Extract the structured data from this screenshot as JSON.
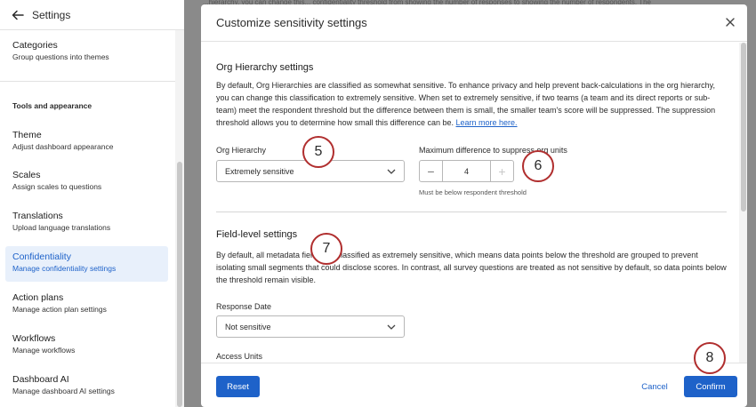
{
  "sidebar": {
    "title": "Settings",
    "back_icon": "arrow-left-icon",
    "top_item": {
      "title": "Categories",
      "subtitle": "Group questions into themes"
    },
    "section_label": "Tools and appearance",
    "items": [
      {
        "title": "Theme",
        "subtitle": "Adjust dashboard appearance"
      },
      {
        "title": "Scales",
        "subtitle": "Assign scales to questions"
      },
      {
        "title": "Translations",
        "subtitle": "Upload language translations"
      },
      {
        "title": "Confidentiality",
        "subtitle": "Manage confidentiality settings",
        "active": true
      },
      {
        "title": "Action plans",
        "subtitle": "Manage action plan settings"
      },
      {
        "title": "Workflows",
        "subtitle": "Manage workflows"
      },
      {
        "title": "Dashboard AI",
        "subtitle": "Manage dashboard AI settings"
      }
    ]
  },
  "background_text": "...hierarchy, you can change this... confidentiality threshold from showing the number of responses to showing the number of respondents. The",
  "modal": {
    "title": "Customize sensitivity settings",
    "close_icon": "close-icon",
    "org_section": {
      "heading": "Org Hierarchy settings",
      "description": "By default, Org Hierarchies are classified as somewhat sensitive. To enhance privacy and help prevent back-calculations in the org hierarchy, you can change this classification to extremely sensitive. When set to extremely sensitive, if two teams (a team and its direct reports or sub-team) meet the respondent threshold but the difference between them is small, the smaller team's score will be suppressed. The suppression threshold allows you to determine how small this difference can be.",
      "learn_more": "Learn more here.",
      "org_hierarchy_label": "Org Hierarchy",
      "org_hierarchy_value": "Extremely sensitive",
      "max_diff_label": "Maximum difference to suppress org units",
      "max_diff_value": "4",
      "minus": "−",
      "plus": "+",
      "hint": "Must be below respondent threshold"
    },
    "field_section": {
      "heading": "Field-level settings",
      "description": "By default, all metadata fields are classified as extremely sensitive, which means data points below the threshold are grouped to prevent isolating small segments that could disclose scores. In contrast, all survey questions are treated as not sensitive by default, so data points below the threshold remain visible.",
      "response_date_label": "Response Date",
      "response_date_value": "Not sensitive",
      "access_units_label": "Access Units"
    },
    "footer": {
      "reset": "Reset",
      "cancel": "Cancel",
      "confirm": "Confirm"
    }
  },
  "callouts": [
    "5",
    "6",
    "7",
    "8"
  ],
  "colors": {
    "accent": "#1e62c9",
    "callout_border": "#b02e2e",
    "active_bg": "#e8f0fb"
  }
}
